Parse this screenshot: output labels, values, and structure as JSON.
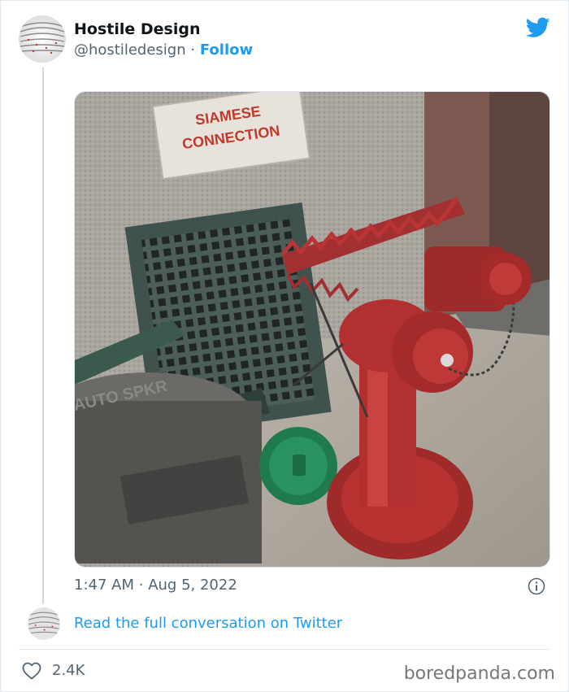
{
  "author": {
    "name": "Hostile Design",
    "handle": "@hostiledesign",
    "separator": "·",
    "follow_label": "Follow",
    "avatar": "op-art-avatar"
  },
  "brand_icon": "twitter-bird-icon",
  "colors": {
    "twitter_blue": "#1d9bf0",
    "secondary_text": "#536471",
    "border": "#e1e8ed"
  },
  "media": {
    "sign_line1": "SIAMESE",
    "sign_line2": "CONNECTION",
    "embossed_text": "AUTO SPKR"
  },
  "tweet": {
    "time": "1:47 AM",
    "separator": "·",
    "date": "Aug 5, 2022"
  },
  "conversation_link": "Read the full conversation on Twitter",
  "likes": "2.4K",
  "watermark": "boredpanda.com"
}
